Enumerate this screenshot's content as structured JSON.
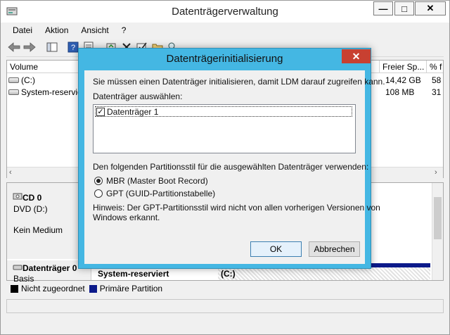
{
  "window": {
    "title": "Datenträgerverwaltung",
    "minimize": "—",
    "maximize": "□",
    "close": "✕"
  },
  "menu": [
    "Datei",
    "Aktion",
    "Ansicht",
    "?"
  ],
  "volume_table": {
    "headers": [
      "Volume",
      "Freier Sp...",
      "% f"
    ],
    "rows": [
      {
        "name": "(C:)",
        "free": "14,42 GB",
        "pct": "58"
      },
      {
        "name": "System-reservie",
        "free": "108 MB",
        "pct": "31"
      }
    ]
  },
  "disks": {
    "cd": {
      "name": "CD 0",
      "type": "DVD (D:)",
      "status": "Kein Medium"
    },
    "disk0": {
      "name": "Datenträger 0",
      "type": "Basis"
    },
    "partitions": [
      {
        "label": "System-reserviert"
      },
      {
        "label": "(C:)"
      }
    ]
  },
  "legend": {
    "unallocated": "Nicht zugeordnet",
    "primary": "Primäre Partition",
    "colors": {
      "unallocated": "#000000",
      "primary": "#0c1a8a"
    }
  },
  "dialog": {
    "title": "Datenträgerinitialisierung",
    "close": "✕",
    "intro": "Sie müssen einen Datenträger initialisieren, damit LDM darauf zugreifen kann.",
    "select_label": "Datenträger auswählen:",
    "disk_item": "Datenträger 1",
    "style_label": "Den folgenden Partitionsstil für die ausgewählten Datenträger verwenden:",
    "option_mbr": "MBR (Master Boot Record)",
    "option_gpt": "GPT (GUID-Partitionstabelle)",
    "hint_line1": "Hinweis: Der GPT-Partitionsstil wird nicht von allen vorherigen Versionen von",
    "hint_line2": "Windows erkannt.",
    "ok": "OK",
    "cancel": "Abbrechen"
  },
  "colors": {
    "dialog_frame": "#44b7e3",
    "close_red": "#c84031"
  }
}
